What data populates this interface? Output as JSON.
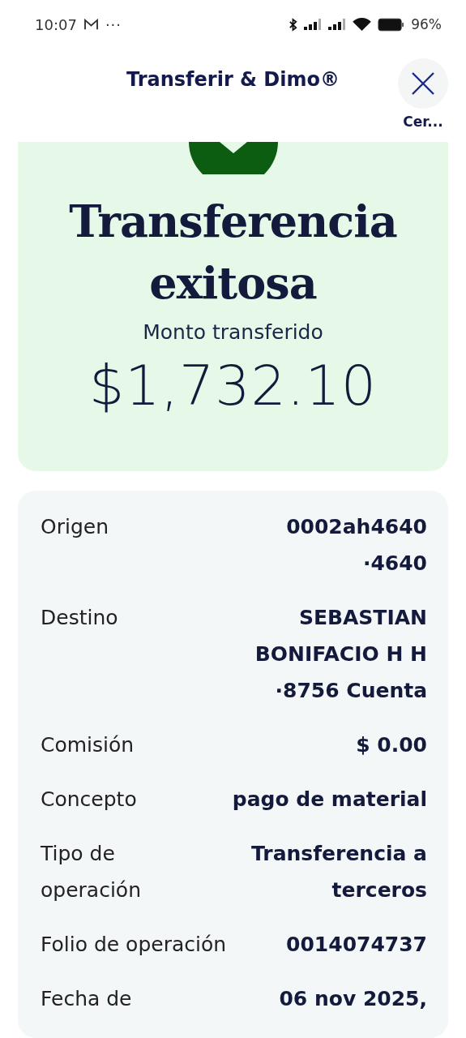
{
  "status_bar": {
    "time": "10:07",
    "more": "···",
    "battery": "96%"
  },
  "header": {
    "title": "Transferir & Dimo®",
    "close_label": "Cer..."
  },
  "result": {
    "title_lines": [
      "Transferencia",
      "exitosa"
    ],
    "amount_label": "Monto transferido",
    "amount": "$1,732.10"
  },
  "details": [
    {
      "label_lines": [
        "Origen"
      ],
      "value_lines": [
        "0002ah4640",
        "·4640"
      ]
    },
    {
      "label_lines": [
        "Destino"
      ],
      "value_lines": [
        "SEBASTIAN",
        "BONIFACIO H H",
        "·8756 Cuenta"
      ]
    },
    {
      "label_lines": [
        "Comisión"
      ],
      "value_lines": [
        "$ 0.00"
      ]
    },
    {
      "label_lines": [
        "Concepto"
      ],
      "value_lines": [
        "pago de material"
      ]
    },
    {
      "label_lines": [
        "Tipo de",
        "operación"
      ],
      "value_lines": [
        "Transferencia a",
        "terceros"
      ]
    },
    {
      "label_lines": [
        "Folio de operación"
      ],
      "value_lines": [
        "0014074737"
      ]
    },
    {
      "label_lines": [
        "Fecha de"
      ],
      "value_lines": [
        "06 nov 2025,"
      ]
    }
  ]
}
